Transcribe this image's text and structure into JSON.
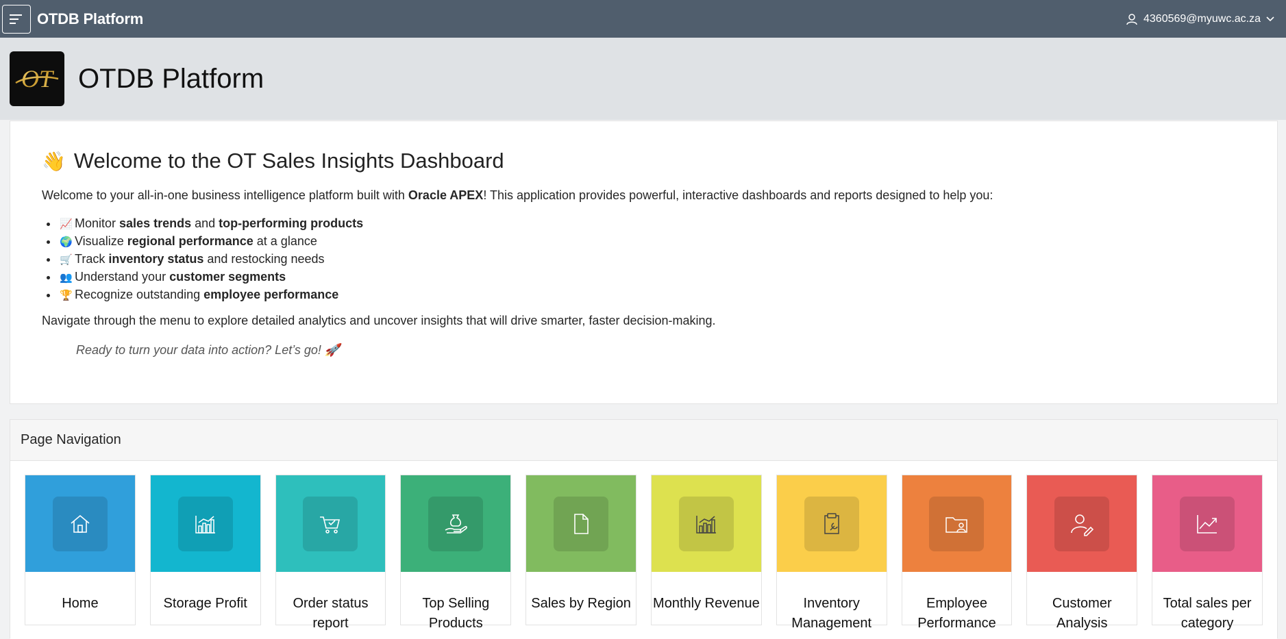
{
  "header": {
    "app_name": "OTDB Platform",
    "user": "4360569@myuwc.ac.za"
  },
  "titlebar": {
    "title": "OTDB Platform",
    "logo_text": "OT"
  },
  "welcome": {
    "heading": "Welcome to the OT Sales Insights Dashboard",
    "intro_before": "Welcome to your all-in-one business intelligence platform built with ",
    "intro_bold": "Oracle APEX",
    "intro_after": "! This application provides powerful, interactive dashboards and reports designed to help you:",
    "bullets": [
      {
        "pre": "Monitor ",
        "b1": "sales trends",
        "mid": " and ",
        "b2": "top-performing products",
        "post": ""
      },
      {
        "pre": "Visualize ",
        "b1": "regional performance",
        "mid": " at a glance",
        "b2": "",
        "post": ""
      },
      {
        "pre": "Track ",
        "b1": "inventory status",
        "mid": " and restocking needs",
        "b2": "",
        "post": ""
      },
      {
        "pre": "Understand your ",
        "b1": "customer segments",
        "mid": "",
        "b2": "",
        "post": ""
      },
      {
        "pre": "Recognize outstanding ",
        "b1": "employee performance",
        "mid": "",
        "b2": "",
        "post": ""
      }
    ],
    "navigate": "Navigate through the menu to explore detailed analytics and uncover insights that will drive smarter, faster decision-making.",
    "cta": "Ready to turn your data into action? Let’s go!"
  },
  "navigation": {
    "title": "Page Navigation",
    "tiles": [
      {
        "label": "Home",
        "color": "#309fdb",
        "icon": "home-icon"
      },
      {
        "label": "Storage Profit",
        "color": "#13b6cf",
        "icon": "bar-chart-icon"
      },
      {
        "label": "Order status report",
        "color": "#2ebfbc",
        "icon": "cart-icon"
      },
      {
        "label": "Top Selling Products",
        "color": "#3cb079",
        "icon": "money-hand-icon"
      },
      {
        "label": "Sales by Region",
        "color": "#81bb5f",
        "icon": "document-icon"
      },
      {
        "label": "Monthly Revenue",
        "color": "#dde14f",
        "icon": "bar-chart-icon"
      },
      {
        "label": "Inventory Management",
        "color": "#fbce4a",
        "icon": "clipboard-wrench-icon"
      },
      {
        "label": "Employee Performance",
        "color": "#ed813e",
        "icon": "folder-user-icon"
      },
      {
        "label": "Customer Analysis",
        "color": "#e95b54",
        "icon": "user-edit-icon"
      },
      {
        "label": "Total sales per category",
        "color": "#e85d88",
        "icon": "line-chart-icon"
      }
    ]
  }
}
